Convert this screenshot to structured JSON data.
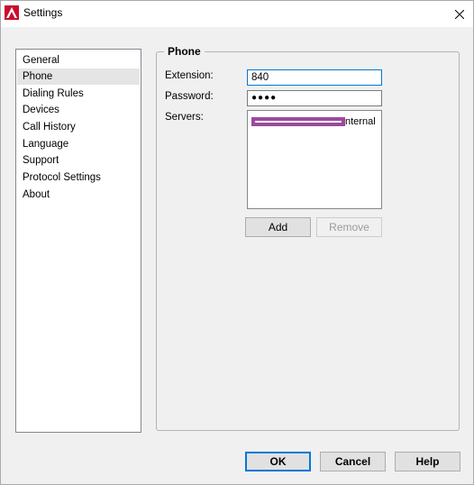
{
  "window": {
    "title": "Settings",
    "app_icon": "app-logo-icon",
    "close_icon": "close-icon"
  },
  "nav": {
    "items": [
      {
        "label": "General"
      },
      {
        "label": "Phone",
        "selected": true
      },
      {
        "label": "Dialing Rules"
      },
      {
        "label": "Devices"
      },
      {
        "label": "Call History"
      },
      {
        "label": "Language"
      },
      {
        "label": "Support"
      },
      {
        "label": "Protocol Settings"
      },
      {
        "label": "About"
      }
    ]
  },
  "phone": {
    "group_title": "Phone",
    "extension_label": "Extension:",
    "extension_value": "840",
    "password_label": "Password:",
    "password_value": "●●●●",
    "servers_label": "Servers:",
    "servers": [
      {
        "visible_text": "nternal",
        "redacted": true
      }
    ],
    "add_label": "Add",
    "remove_label": "Remove"
  },
  "footer": {
    "ok_label": "OK",
    "cancel_label": "Cancel",
    "help_label": "Help"
  },
  "colors": {
    "accent": "#0078d7",
    "brand": "#c8102e",
    "redaction": "#9b4a9b"
  }
}
